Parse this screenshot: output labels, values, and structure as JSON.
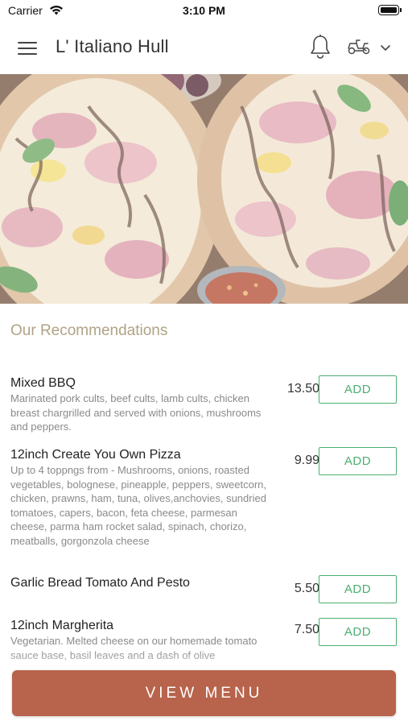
{
  "status_bar": {
    "carrier": "Carrier",
    "time": "3:10 PM"
  },
  "header": {
    "title": "L' Italiano Hull",
    "icons": [
      "menu-icon",
      "bell-icon",
      "scooter-icon",
      "chevron-down-icon"
    ]
  },
  "hero": {
    "icon": "pizza-photo"
  },
  "recommendations": {
    "title": "Our Recommendations",
    "items": [
      {
        "name": "Mixed BBQ",
        "description": "Marinated pork cults, beef cults, lamb cults, chicken breast chargrilled and served with onions, mushrooms and peppers.",
        "price": "13.50",
        "button": "ADD"
      },
      {
        "name": "12inch Create You Own Pizza",
        "description": "Up to 4 toppngs from - Mushrooms, onions, roasted vegetables, bolognese, pineapple, peppers, sweetcorn, chicken, prawns, ham, tuna, olives,anchovies, sundried tomatoes, capers, bacon, feta cheese, parmesan cheese, parma ham rocket salad, spinach, chorizo, meatballs, gorgonzola cheese",
        "price": "9.99",
        "button": "ADD"
      },
      {
        "name": "Garlic Bread Tomato And Pesto",
        "description": "",
        "price": "5.50",
        "button": "ADD"
      },
      {
        "name": "12inch Margherita",
        "description": "Vegetarian. Melted cheese on our homemade tomato sauce base, basil leaves and a dash of olive",
        "price": "7.50",
        "button": "ADD"
      }
    ]
  },
  "footer": {
    "view_menu_label": "VIEW MENU"
  },
  "colors": {
    "accent_green": "#4caf72",
    "view_menu_bg": "#b8634b",
    "section_title": "#b0a386"
  }
}
